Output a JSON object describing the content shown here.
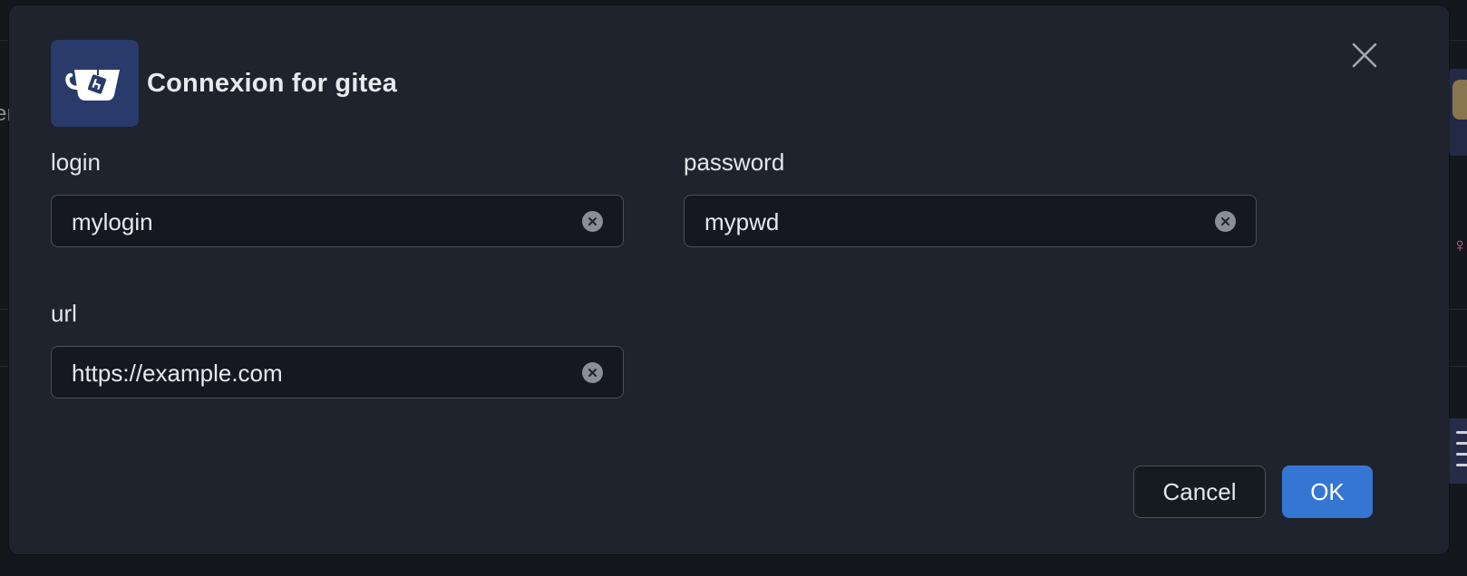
{
  "dialog": {
    "title": "Connexion for gitea",
    "icon": "gitea-teacup-icon",
    "close_icon": "close-icon"
  },
  "fields": {
    "login": {
      "label": "login",
      "value": "mylogin"
    },
    "password": {
      "label": "password",
      "value": "mypwd"
    },
    "url": {
      "label": "url",
      "value": "https://example.com"
    }
  },
  "buttons": {
    "cancel_label": "Cancel",
    "ok_label": "OK"
  },
  "background": {
    "left_text": "er"
  },
  "colors": {
    "dialog_bg": "#1f232d",
    "field_bg": "#151821",
    "accent": "#3576d3",
    "app_icon_bg": "#2a3a6b"
  }
}
